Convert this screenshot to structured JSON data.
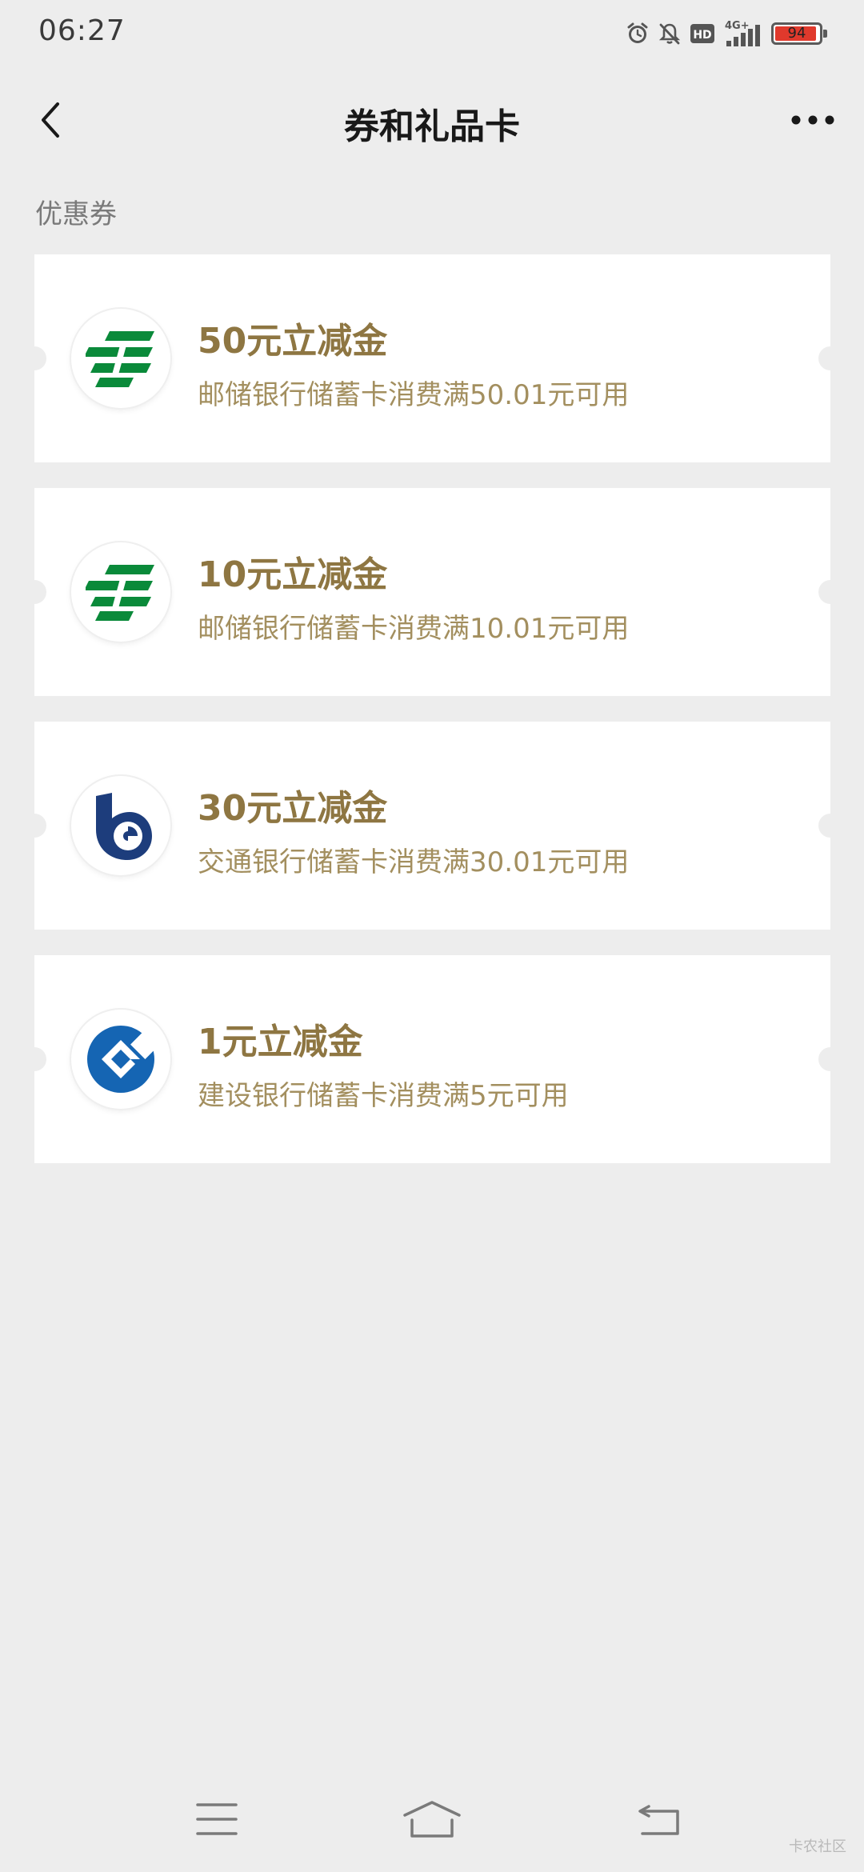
{
  "status_bar": {
    "time": "06:27",
    "network": "4G+",
    "hd": "HD",
    "battery_level": "94",
    "battery_fraction": 0.94,
    "icons": [
      "alarm-icon",
      "notifications-off-icon",
      "hd-icon",
      "signal-icon",
      "battery-icon"
    ]
  },
  "nav": {
    "title": "券和礼品卡",
    "back_icon": "chevron-left-icon",
    "more_icon": "more-dots-icon"
  },
  "section": {
    "label": "优惠券"
  },
  "coupons": [
    {
      "title": "50元立减金",
      "description": "邮储银行储蓄卡消费满50.01元可用",
      "bank_logo": "psbc-logo-icon"
    },
    {
      "title": "10元立减金",
      "description": "邮储银行储蓄卡消费满10.01元可用",
      "bank_logo": "psbc-logo-icon"
    },
    {
      "title": "30元立减金",
      "description": "交通银行储蓄卡消费满30.01元可用",
      "bank_logo": "bocom-logo-icon"
    },
    {
      "title": "1元立减金",
      "description": "建设银行储蓄卡消费满5元可用",
      "bank_logo": "ccb-logo-icon"
    }
  ],
  "system_nav": {
    "icons": [
      "menu-icon",
      "home-icon",
      "back-icon"
    ]
  },
  "watermark": "卡农社区",
  "colors": {
    "background": "#ededed",
    "card": "#ffffff",
    "coupon_title": "#8e7642",
    "coupon_desc": "#a38f5f",
    "psbc_green": "#0a8a3a",
    "bocom_blue": "#1d3d7c",
    "ccb_blue": "#1565b3"
  }
}
